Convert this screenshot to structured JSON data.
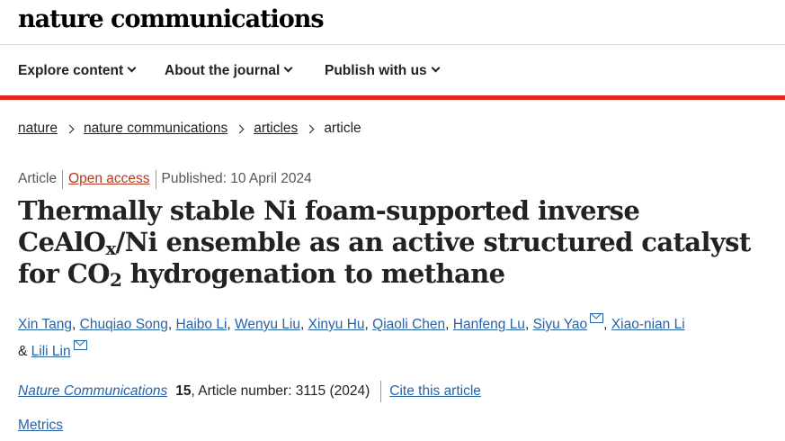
{
  "header": {
    "logo": "nature communications"
  },
  "nav": {
    "items": [
      {
        "label": "Explore content"
      },
      {
        "label": "About the journal"
      },
      {
        "label": "Publish with us"
      }
    ]
  },
  "breadcrumb": [
    "nature",
    "nature communications",
    "articles",
    "article"
  ],
  "meta": {
    "type": "Article",
    "access": "Open access",
    "published": "Published: 10 April 2024"
  },
  "title": {
    "part1": "Thermally stable Ni foam-supported inverse CeAlO",
    "sub1": "x",
    "part2": "/Ni ensemble as an active structured catalyst for CO",
    "sub2": "2",
    "part3": " hydrogenation to methane"
  },
  "authors": [
    "Xin Tang",
    "Chuqiao Song",
    "Haibo Li",
    "Wenyu Liu",
    "Xinyu Hu",
    "Qiaoli Chen",
    "Hanfeng Lu",
    "Siyu Yao",
    "Xiao-nian Li",
    "Lili Lin"
  ],
  "author_separators": {
    "comma": ", ",
    "and": "& "
  },
  "citation": {
    "journal": "Nature Communications",
    "volume": "15",
    "article": ", Article number: 3115 (2024)",
    "cite_label": "Cite this article"
  },
  "metrics_label": "Metrics",
  "colors": {
    "accent_red": "#e12a1d",
    "link_blue": "#2863a5",
    "open_access": "#b4391f"
  }
}
